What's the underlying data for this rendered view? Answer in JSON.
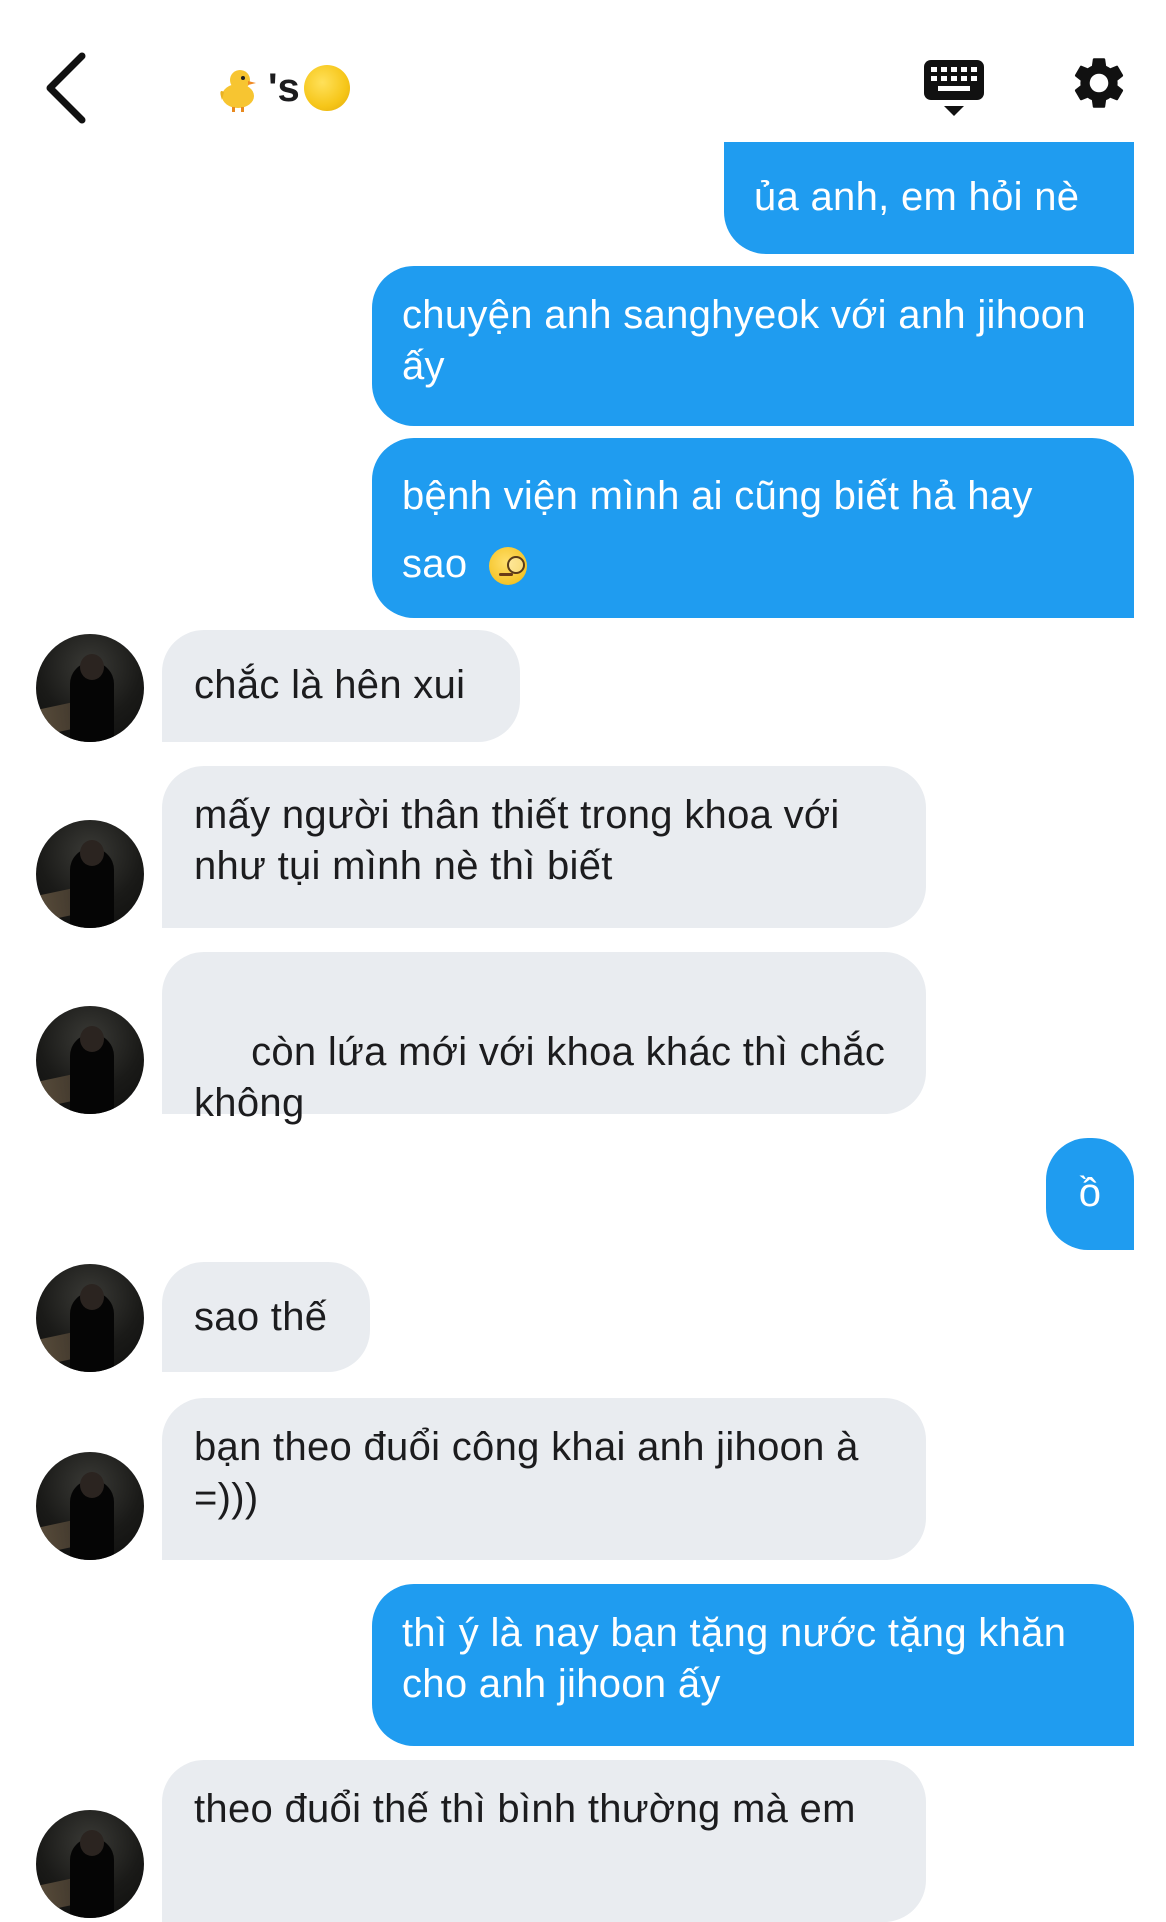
{
  "header": {
    "title_suffix": "'s",
    "icons": {
      "back": "chevron-left-icon",
      "title_left_emoji": "baby-chick-icon",
      "title_right_emoji": "full-moon-icon",
      "keyboard": "keyboard-icon",
      "settings": "gear-icon"
    }
  },
  "colors": {
    "outgoing_bubble": "#1f9cf0",
    "incoming_bubble": "#e9ecf0",
    "outgoing_text": "#ffffff",
    "incoming_text": "#1c1c1e"
  },
  "messages": [
    {
      "dir": "out",
      "text": "ủa anh, em hỏi nè"
    },
    {
      "dir": "out",
      "text": "chuyện anh sanghyeok với anh jihoon ấy"
    },
    {
      "dir": "out",
      "text": "bệnh viện mình ai cũng biết hả hay sao",
      "emoji": "face-with-monocle-icon"
    },
    {
      "dir": "in",
      "text": "chắc là hên xui"
    },
    {
      "dir": "in",
      "text": "mấy người thân thiết trong khoa với như tụi mình nè thì biết"
    },
    {
      "dir": "in",
      "text": " còn lứa mới với khoa khác thì chắc không"
    },
    {
      "dir": "out",
      "text": "ồ"
    },
    {
      "dir": "in",
      "text": "sao thế"
    },
    {
      "dir": "in",
      "text": "bạn theo đuổi công khai anh jihoon à =)))"
    },
    {
      "dir": "out",
      "text": "thì ý là nay bạn tặng nước tặng khăn cho anh jihoon ấy"
    },
    {
      "dir": "in",
      "text": "theo đuổi thế thì bình thường mà em"
    }
  ]
}
